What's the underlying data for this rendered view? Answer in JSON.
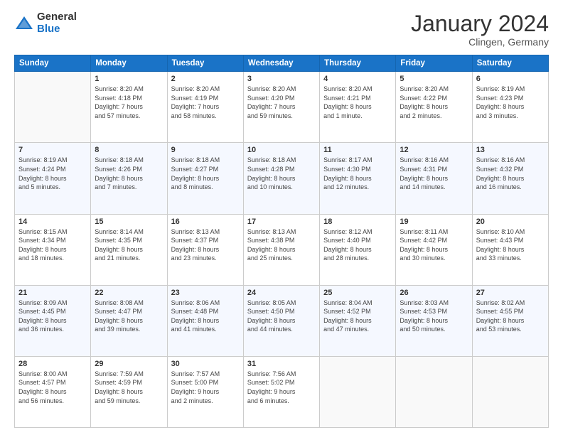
{
  "logo": {
    "general": "General",
    "blue": "Blue"
  },
  "header": {
    "title": "January 2024",
    "subtitle": "Clingen, Germany"
  },
  "columns": [
    "Sunday",
    "Monday",
    "Tuesday",
    "Wednesday",
    "Thursday",
    "Friday",
    "Saturday"
  ],
  "weeks": [
    [
      {
        "day": "",
        "info": ""
      },
      {
        "day": "1",
        "info": "Sunrise: 8:20 AM\nSunset: 4:18 PM\nDaylight: 7 hours\nand 57 minutes."
      },
      {
        "day": "2",
        "info": "Sunrise: 8:20 AM\nSunset: 4:19 PM\nDaylight: 7 hours\nand 58 minutes."
      },
      {
        "day": "3",
        "info": "Sunrise: 8:20 AM\nSunset: 4:20 PM\nDaylight: 7 hours\nand 59 minutes."
      },
      {
        "day": "4",
        "info": "Sunrise: 8:20 AM\nSunset: 4:21 PM\nDaylight: 8 hours\nand 1 minute."
      },
      {
        "day": "5",
        "info": "Sunrise: 8:20 AM\nSunset: 4:22 PM\nDaylight: 8 hours\nand 2 minutes."
      },
      {
        "day": "6",
        "info": "Sunrise: 8:19 AM\nSunset: 4:23 PM\nDaylight: 8 hours\nand 3 minutes."
      }
    ],
    [
      {
        "day": "7",
        "info": "Sunrise: 8:19 AM\nSunset: 4:24 PM\nDaylight: 8 hours\nand 5 minutes."
      },
      {
        "day": "8",
        "info": "Sunrise: 8:18 AM\nSunset: 4:26 PM\nDaylight: 8 hours\nand 7 minutes."
      },
      {
        "day": "9",
        "info": "Sunrise: 8:18 AM\nSunset: 4:27 PM\nDaylight: 8 hours\nand 8 minutes."
      },
      {
        "day": "10",
        "info": "Sunrise: 8:18 AM\nSunset: 4:28 PM\nDaylight: 8 hours\nand 10 minutes."
      },
      {
        "day": "11",
        "info": "Sunrise: 8:17 AM\nSunset: 4:30 PM\nDaylight: 8 hours\nand 12 minutes."
      },
      {
        "day": "12",
        "info": "Sunrise: 8:16 AM\nSunset: 4:31 PM\nDaylight: 8 hours\nand 14 minutes."
      },
      {
        "day": "13",
        "info": "Sunrise: 8:16 AM\nSunset: 4:32 PM\nDaylight: 8 hours\nand 16 minutes."
      }
    ],
    [
      {
        "day": "14",
        "info": "Sunrise: 8:15 AM\nSunset: 4:34 PM\nDaylight: 8 hours\nand 18 minutes."
      },
      {
        "day": "15",
        "info": "Sunrise: 8:14 AM\nSunset: 4:35 PM\nDaylight: 8 hours\nand 21 minutes."
      },
      {
        "day": "16",
        "info": "Sunrise: 8:13 AM\nSunset: 4:37 PM\nDaylight: 8 hours\nand 23 minutes."
      },
      {
        "day": "17",
        "info": "Sunrise: 8:13 AM\nSunset: 4:38 PM\nDaylight: 8 hours\nand 25 minutes."
      },
      {
        "day": "18",
        "info": "Sunrise: 8:12 AM\nSunset: 4:40 PM\nDaylight: 8 hours\nand 28 minutes."
      },
      {
        "day": "19",
        "info": "Sunrise: 8:11 AM\nSunset: 4:42 PM\nDaylight: 8 hours\nand 30 minutes."
      },
      {
        "day": "20",
        "info": "Sunrise: 8:10 AM\nSunset: 4:43 PM\nDaylight: 8 hours\nand 33 minutes."
      }
    ],
    [
      {
        "day": "21",
        "info": "Sunrise: 8:09 AM\nSunset: 4:45 PM\nDaylight: 8 hours\nand 36 minutes."
      },
      {
        "day": "22",
        "info": "Sunrise: 8:08 AM\nSunset: 4:47 PM\nDaylight: 8 hours\nand 39 minutes."
      },
      {
        "day": "23",
        "info": "Sunrise: 8:06 AM\nSunset: 4:48 PM\nDaylight: 8 hours\nand 41 minutes."
      },
      {
        "day": "24",
        "info": "Sunrise: 8:05 AM\nSunset: 4:50 PM\nDaylight: 8 hours\nand 44 minutes."
      },
      {
        "day": "25",
        "info": "Sunrise: 8:04 AM\nSunset: 4:52 PM\nDaylight: 8 hours\nand 47 minutes."
      },
      {
        "day": "26",
        "info": "Sunrise: 8:03 AM\nSunset: 4:53 PM\nDaylight: 8 hours\nand 50 minutes."
      },
      {
        "day": "27",
        "info": "Sunrise: 8:02 AM\nSunset: 4:55 PM\nDaylight: 8 hours\nand 53 minutes."
      }
    ],
    [
      {
        "day": "28",
        "info": "Sunrise: 8:00 AM\nSunset: 4:57 PM\nDaylight: 8 hours\nand 56 minutes."
      },
      {
        "day": "29",
        "info": "Sunrise: 7:59 AM\nSunset: 4:59 PM\nDaylight: 8 hours\nand 59 minutes."
      },
      {
        "day": "30",
        "info": "Sunrise: 7:57 AM\nSunset: 5:00 PM\nDaylight: 9 hours\nand 2 minutes."
      },
      {
        "day": "31",
        "info": "Sunrise: 7:56 AM\nSunset: 5:02 PM\nDaylight: 9 hours\nand 6 minutes."
      },
      {
        "day": "",
        "info": ""
      },
      {
        "day": "",
        "info": ""
      },
      {
        "day": "",
        "info": ""
      }
    ]
  ]
}
